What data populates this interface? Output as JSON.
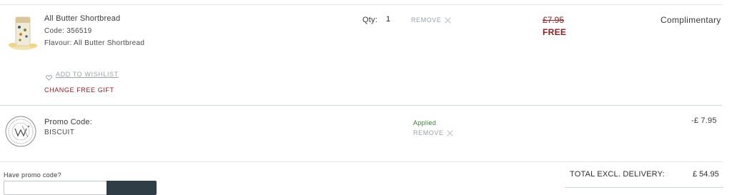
{
  "item": {
    "name": "All Butter Shortbread",
    "code": "Code: 356519",
    "flavour": "Flavour: All Butter Shortbread",
    "qty_label": "Qty:",
    "qty_value": "1",
    "remove_label": "REMOVE",
    "old_price": "£7.95",
    "new_price": "FREE",
    "status": "Complimentary",
    "wishlist_label": "ADD TO WISHLIST",
    "change_gift_label": "CHANGE FREE GIFT"
  },
  "promo": {
    "label": "Promo Code:",
    "code": "BISCUIT",
    "status": "Applied",
    "remove_label": "REMOVE",
    "amount": "-£ 7.95"
  },
  "footer": {
    "have_promo_label": "Have promo code?",
    "total_label": "TOTAL EXCL. DELIVERY:",
    "total_value": "£ 54.95"
  },
  "colors": {
    "accent_red": "#8a1f23",
    "applied_green": "#3e7d3a",
    "divider": "#cfd8dc",
    "button_dark": "#2f3e46"
  },
  "icons": {
    "product": "product-thumbnail",
    "heart": "heart-icon",
    "remove": "close-icon",
    "promo_badge": "promo-seal-icon"
  }
}
